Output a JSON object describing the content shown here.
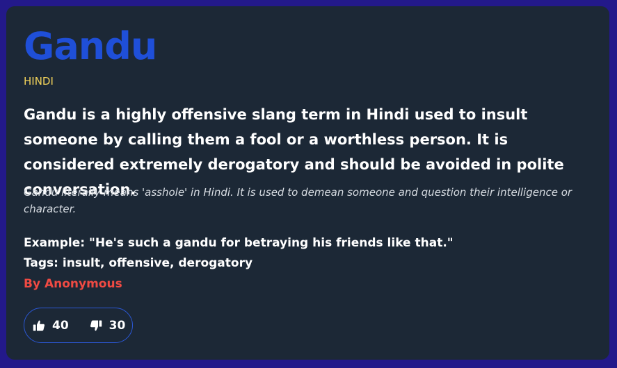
{
  "entry": {
    "term": "Gandu",
    "language": "HINDI",
    "definition": "Gandu is a highly offensive slang term in Hindi used to insult someone by calling them a fool or a worthless person. It is considered extremely derogatory and should be avoided in polite conversation.",
    "meaning": "Gandu literally means 'asshole' in Hindi. It is used to demean someone and question their intelligence or character.",
    "example": "Example: \"He's such a gandu for betraying his friends like that.\"",
    "tags": "Tags: insult, offensive, derogatory",
    "author": "By Anonymous"
  },
  "votes": {
    "up_icon": "thumbs-up-icon",
    "up_count": "40",
    "down_icon": "thumbs-down-icon",
    "down_count": "30"
  },
  "colors": {
    "background": "#23198a",
    "card": "#1c2836",
    "title": "#1f4fd8",
    "language": "#f2d35a",
    "author": "#f04a43",
    "vote_border": "#2b58d6"
  }
}
